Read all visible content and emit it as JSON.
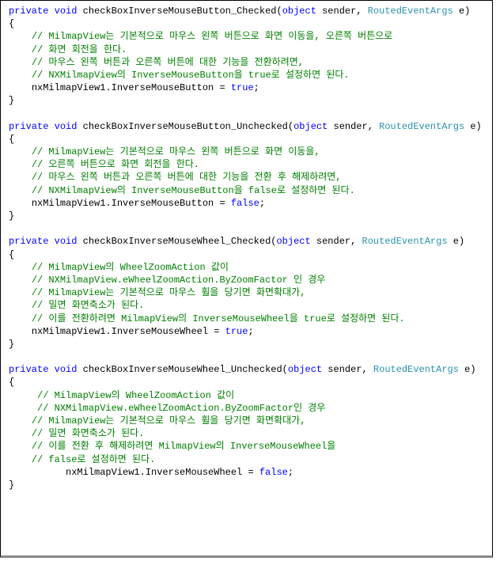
{
  "tokens": [
    {
      "t": "private",
      "c": "kw"
    },
    {
      "t": " ",
      "c": "plain"
    },
    {
      "t": "void",
      "c": "kw"
    },
    {
      "t": " checkBoxInverseMouseButton_Checked(",
      "c": "plain"
    },
    {
      "t": "object",
      "c": "kw"
    },
    {
      "t": " sender, ",
      "c": "plain"
    },
    {
      "t": "RoutedEventArgs",
      "c": "type"
    },
    {
      "t": " e)\n",
      "c": "plain"
    },
    {
      "t": "{\n",
      "c": "plain"
    },
    {
      "t": "    ",
      "c": "plain"
    },
    {
      "t": "// MilmapView는 기본적으로 마우스 왼쪽 버튼으로 화면 이동을, 오른쪽 버튼으로",
      "c": "cmt"
    },
    {
      "t": "\n",
      "c": "plain"
    },
    {
      "t": "    ",
      "c": "plain"
    },
    {
      "t": "// 화면 회전을 한다.",
      "c": "cmt"
    },
    {
      "t": "\n",
      "c": "plain"
    },
    {
      "t": "    ",
      "c": "plain"
    },
    {
      "t": "// 마우스 왼쪽 버튼과 오른쪽 버튼에 대한 기능을 전환하려면,",
      "c": "cmt"
    },
    {
      "t": "\n",
      "c": "plain"
    },
    {
      "t": "    ",
      "c": "plain"
    },
    {
      "t": "// NXMilmapView의 InverseMouseButton을 true로 설정하면 된다.",
      "c": "cmt"
    },
    {
      "t": "\n",
      "c": "plain"
    },
    {
      "t": "    nxMilmapView1.InverseMouseButton = ",
      "c": "plain"
    },
    {
      "t": "true",
      "c": "kw"
    },
    {
      "t": ";\n",
      "c": "plain"
    },
    {
      "t": "}\n",
      "c": "plain"
    },
    {
      "t": "\n",
      "c": "plain"
    },
    {
      "t": "private",
      "c": "kw"
    },
    {
      "t": " ",
      "c": "plain"
    },
    {
      "t": "void",
      "c": "kw"
    },
    {
      "t": " checkBoxInverseMouseButton_Unchecked(",
      "c": "plain"
    },
    {
      "t": "object",
      "c": "kw"
    },
    {
      "t": " sender, ",
      "c": "plain"
    },
    {
      "t": "RoutedEventArgs",
      "c": "type"
    },
    {
      "t": " e)\n",
      "c": "plain"
    },
    {
      "t": "{\n",
      "c": "plain"
    },
    {
      "t": "    ",
      "c": "plain"
    },
    {
      "t": "// MilmapView는 기본적으로 마우스 왼쪽 버튼으로 화면 이동을,",
      "c": "cmt"
    },
    {
      "t": "\n",
      "c": "plain"
    },
    {
      "t": "    ",
      "c": "plain"
    },
    {
      "t": "// 오른쪽 버튼으로 화면 회전을 한다.",
      "c": "cmt"
    },
    {
      "t": "\n",
      "c": "plain"
    },
    {
      "t": "    ",
      "c": "plain"
    },
    {
      "t": "// 마우스 왼쪽 버튼과 오른쪽 버튼에 대한 기능을 전환 후 해제하려면,",
      "c": "cmt"
    },
    {
      "t": "\n",
      "c": "plain"
    },
    {
      "t": "    ",
      "c": "plain"
    },
    {
      "t": "// NXMilmapView의 InverseMouseButton을 false로 설정하면 된다.",
      "c": "cmt"
    },
    {
      "t": "\n",
      "c": "plain"
    },
    {
      "t": "    nxMilmapView1.InverseMouseButton = ",
      "c": "plain"
    },
    {
      "t": "false",
      "c": "kw"
    },
    {
      "t": ";\n",
      "c": "plain"
    },
    {
      "t": "}\n",
      "c": "plain"
    },
    {
      "t": "\n",
      "c": "plain"
    },
    {
      "t": "private",
      "c": "kw"
    },
    {
      "t": " ",
      "c": "plain"
    },
    {
      "t": "void",
      "c": "kw"
    },
    {
      "t": " checkBoxInverseMouseWheel_Checked(",
      "c": "plain"
    },
    {
      "t": "object",
      "c": "kw"
    },
    {
      "t": " sender, ",
      "c": "plain"
    },
    {
      "t": "RoutedEventArgs",
      "c": "type"
    },
    {
      "t": " e)\n",
      "c": "plain"
    },
    {
      "t": "{\n",
      "c": "plain"
    },
    {
      "t": "    ",
      "c": "plain"
    },
    {
      "t": "// MilmapView의 WheelZoomAction 값이",
      "c": "cmt"
    },
    {
      "t": "\n",
      "c": "plain"
    },
    {
      "t": "    ",
      "c": "plain"
    },
    {
      "t": "// NXMilmapView.eWheelZoomAction.ByZoomFactor 인 경우",
      "c": "cmt"
    },
    {
      "t": "\n",
      "c": "plain"
    },
    {
      "t": "    ",
      "c": "plain"
    },
    {
      "t": "// MilmapView는 기본적으로 마우스 휠을 당기면 화면확대가,",
      "c": "cmt"
    },
    {
      "t": "\n",
      "c": "plain"
    },
    {
      "t": "    ",
      "c": "plain"
    },
    {
      "t": "// 밀면 화면축소가 된다.",
      "c": "cmt"
    },
    {
      "t": "\n",
      "c": "plain"
    },
    {
      "t": "    ",
      "c": "plain"
    },
    {
      "t": "// 이를 전환하려면 MilmapView의 InverseMouseWheel을 true로 설정하면 된다.",
      "c": "cmt"
    },
    {
      "t": "\n",
      "c": "plain"
    },
    {
      "t": "    nxMilmapView1.InverseMouseWheel = ",
      "c": "plain"
    },
    {
      "t": "true",
      "c": "kw"
    },
    {
      "t": ";\n",
      "c": "plain"
    },
    {
      "t": "}\n",
      "c": "plain"
    },
    {
      "t": "\n",
      "c": "plain"
    },
    {
      "t": "private",
      "c": "kw"
    },
    {
      "t": " ",
      "c": "plain"
    },
    {
      "t": "void",
      "c": "kw"
    },
    {
      "t": " checkBoxInverseMouseWheel_Unchecked(",
      "c": "plain"
    },
    {
      "t": "object",
      "c": "kw"
    },
    {
      "t": " sender, ",
      "c": "plain"
    },
    {
      "t": "RoutedEventArgs",
      "c": "type"
    },
    {
      "t": " e)\n",
      "c": "plain"
    },
    {
      "t": "{\n",
      "c": "plain"
    },
    {
      "t": "     ",
      "c": "plain"
    },
    {
      "t": "// MilmapView의 WheelZoomAction 값이",
      "c": "cmt"
    },
    {
      "t": "\n",
      "c": "plain"
    },
    {
      "t": "     ",
      "c": "plain"
    },
    {
      "t": "// NXMilmapView.eWheelZoomAction.ByZoomFactor인 경우",
      "c": "cmt"
    },
    {
      "t": "\n",
      "c": "plain"
    },
    {
      "t": "    ",
      "c": "plain"
    },
    {
      "t": "// MilmapView는 기본적으로 마우스 휠을 당기면 화면확대가,",
      "c": "cmt"
    },
    {
      "t": "\n",
      "c": "plain"
    },
    {
      "t": "    ",
      "c": "plain"
    },
    {
      "t": "// 밀면 화면축소가 된다.",
      "c": "cmt"
    },
    {
      "t": "\n",
      "c": "plain"
    },
    {
      "t": "    ",
      "c": "plain"
    },
    {
      "t": "// 이를 전환 후 해제하려면 MilmapView의 InverseMouseWheel을",
      "c": "cmt"
    },
    {
      "t": "\n",
      "c": "plain"
    },
    {
      "t": "    ",
      "c": "plain"
    },
    {
      "t": "// false로 설정하면 된다.",
      "c": "cmt"
    },
    {
      "t": "\n",
      "c": "plain"
    },
    {
      "t": "          nxMilmapView1.InverseMouseWheel = ",
      "c": "plain"
    },
    {
      "t": "false",
      "c": "kw"
    },
    {
      "t": ";\n",
      "c": "plain"
    },
    {
      "t": "}\n",
      "c": "plain"
    }
  ]
}
